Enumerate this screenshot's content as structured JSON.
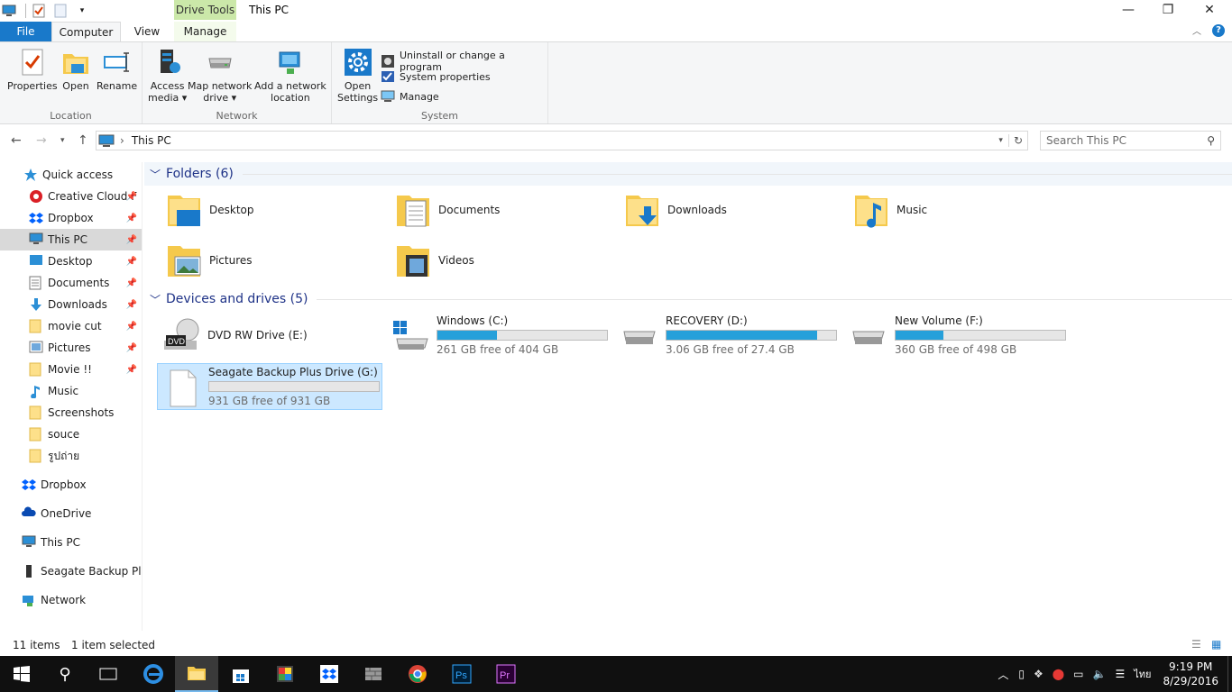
{
  "window": {
    "title": "This PC",
    "context_tab": "Drive Tools"
  },
  "tabs": {
    "file": "File",
    "computer": "Computer",
    "view": "View",
    "manage": "Manage"
  },
  "ribbon": {
    "location": {
      "label": "Location",
      "properties": "Properties",
      "open": "Open",
      "rename": "Rename"
    },
    "network": {
      "label": "Network",
      "access_media_1": "Access",
      "access_media_2": "media ▾",
      "map_drive_1": "Map network",
      "map_drive_2": "drive ▾",
      "add_location_1": "Add a network",
      "add_location_2": "location"
    },
    "system": {
      "label": "System",
      "open_settings_1": "Open",
      "open_settings_2": "Settings",
      "uninstall": "Uninstall or change a program",
      "system_properties": "System properties",
      "manage": "Manage"
    }
  },
  "address": {
    "path": "This PC",
    "search_placeholder": "Search This PC"
  },
  "nav": {
    "items": [
      {
        "label": "Quick access"
      },
      {
        "label": "Creative Cloud F"
      },
      {
        "label": "Dropbox"
      },
      {
        "label": "This PC"
      },
      {
        "label": "Desktop"
      },
      {
        "label": "Documents"
      },
      {
        "label": "Downloads"
      },
      {
        "label": "movie cut"
      },
      {
        "label": "Pictures"
      },
      {
        "label": "Movie !!"
      },
      {
        "label": "Music"
      },
      {
        "label": "Screenshots"
      },
      {
        "label": "souce"
      },
      {
        "label": "รูปถ่าย"
      },
      {
        "label": "Dropbox"
      },
      {
        "label": "OneDrive"
      },
      {
        "label": "This PC"
      },
      {
        "label": "Seagate Backup Plus"
      },
      {
        "label": "Network"
      }
    ]
  },
  "folders": {
    "header": "Folders (6)",
    "items": [
      {
        "label": "Desktop"
      },
      {
        "label": "Documents"
      },
      {
        "label": "Downloads"
      },
      {
        "label": "Music"
      },
      {
        "label": "Pictures"
      },
      {
        "label": "Videos"
      }
    ]
  },
  "drives": {
    "header": "Devices and drives (5)",
    "items": [
      {
        "label": "DVD RW Drive (E:)",
        "free": "",
        "used_fraction": null
      },
      {
        "label": "Windows (C:)",
        "free": "261 GB free of 404 GB",
        "used_fraction": 0.35
      },
      {
        "label": "RECOVERY (D:)",
        "free": "3.06 GB free of 27.4 GB",
        "used_fraction": 0.89
      },
      {
        "label": "New Volume (F:)",
        "free": "360 GB free of 498 GB",
        "used_fraction": 0.28
      },
      {
        "label": "Seagate Backup Plus Drive (G:)",
        "free": "931 GB free of 931 GB",
        "used_fraction": 0.0
      }
    ]
  },
  "status": {
    "items": "11 items",
    "selected": "1 item selected"
  },
  "taskbar": {
    "time": "9:19 PM",
    "date": "8/29/2016",
    "lang": "ไทย"
  },
  "colors": {
    "accent": "#1979ca",
    "bar_fill": "#26a0da",
    "selection": "#cce8ff",
    "taskbar": "#101010"
  }
}
